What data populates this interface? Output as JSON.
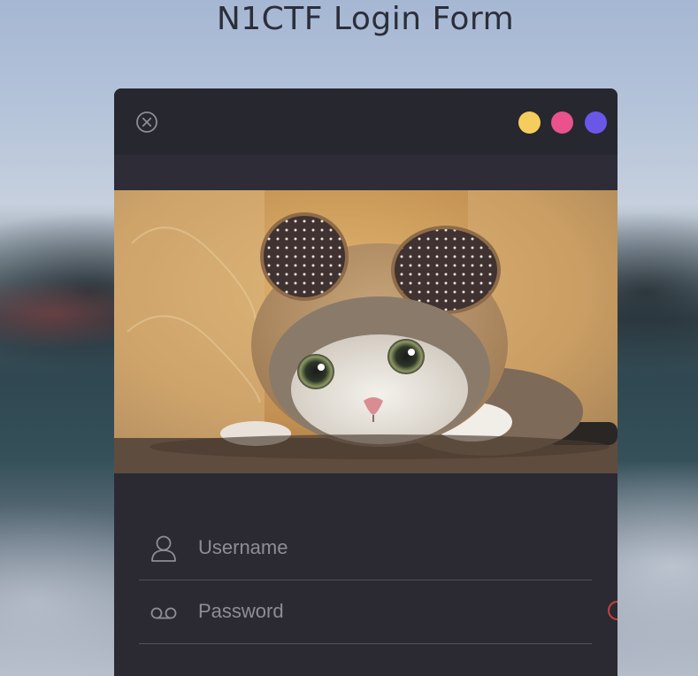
{
  "page": {
    "title": "N1CTF Login Form"
  },
  "window": {
    "close_icon": "close-circle-icon",
    "controls": [
      {
        "name": "yellow",
        "color": "#f5cd5d"
      },
      {
        "name": "pink",
        "color": "#e9528c"
      },
      {
        "name": "purple",
        "color": "#6b57e7"
      }
    ]
  },
  "hero": {
    "subject": "cat wearing bear-ear hood photo"
  },
  "form": {
    "username": {
      "placeholder": "Username",
      "value": "",
      "icon": "user-icon"
    },
    "password": {
      "placeholder": "Password",
      "value": "",
      "icon": "voicemail-icon",
      "status_color": "#c6423c"
    }
  },
  "colors": {
    "card_bg": "#2b2a33",
    "header_bg": "#272730",
    "divider": "#52515c",
    "placeholder": "#8e8d96"
  }
}
